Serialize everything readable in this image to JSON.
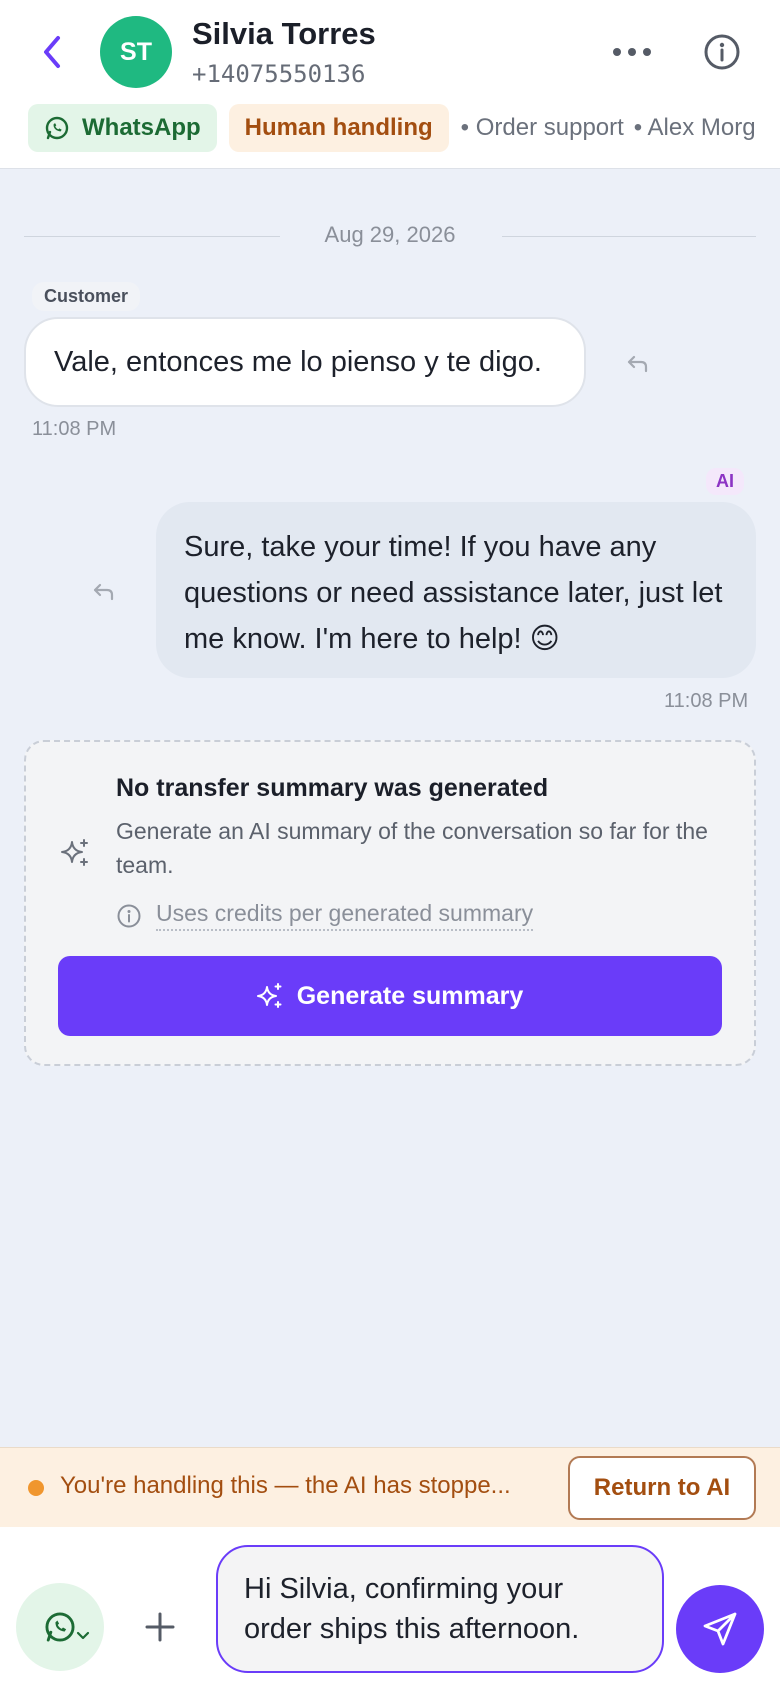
{
  "header": {
    "avatar_initials": "ST",
    "contact_name": "Silvia Torres",
    "contact_phone": "+14075550136",
    "icons": {
      "back": "chevron-left-icon",
      "more": "more-horizontal-icon",
      "info": "info-icon"
    }
  },
  "chips": {
    "channel": "WhatsApp",
    "status": "Human handling",
    "meta": [
      "• Order support",
      "• Alex Morg"
    ]
  },
  "conversation": {
    "date": "Aug 29, 2026",
    "messages": [
      {
        "sender_label": "Customer",
        "text": "Vale, entonces me lo pienso y te digo.",
        "time": "11:08 PM",
        "direction": "incoming"
      },
      {
        "sender_label": "AI",
        "text": "Sure, take your time! If you have any questions or need assistance later, just let me know. I'm here to help! 😊",
        "time": "11:08 PM",
        "direction": "outgoing"
      }
    ]
  },
  "summary_card": {
    "title": "No transfer summary was generated",
    "description": "Generate an AI summary of the conversation so far for the team.",
    "credits_note": "Uses credits per generated summary",
    "button_label": "Generate summary"
  },
  "handling_banner": {
    "text": "You're handling this — the AI has stoppe...",
    "button_label": "Return to AI"
  },
  "composer": {
    "input_value": "Hi Silvia, confirming your order ships this afternoon."
  },
  "colors": {
    "accent": "#6a3cf9",
    "avatar": "#1fb981",
    "whatsapp_chip_bg": "#e3f5e8",
    "human_chip_bg": "#fdf0e1",
    "banner_text": "#a34e10"
  }
}
